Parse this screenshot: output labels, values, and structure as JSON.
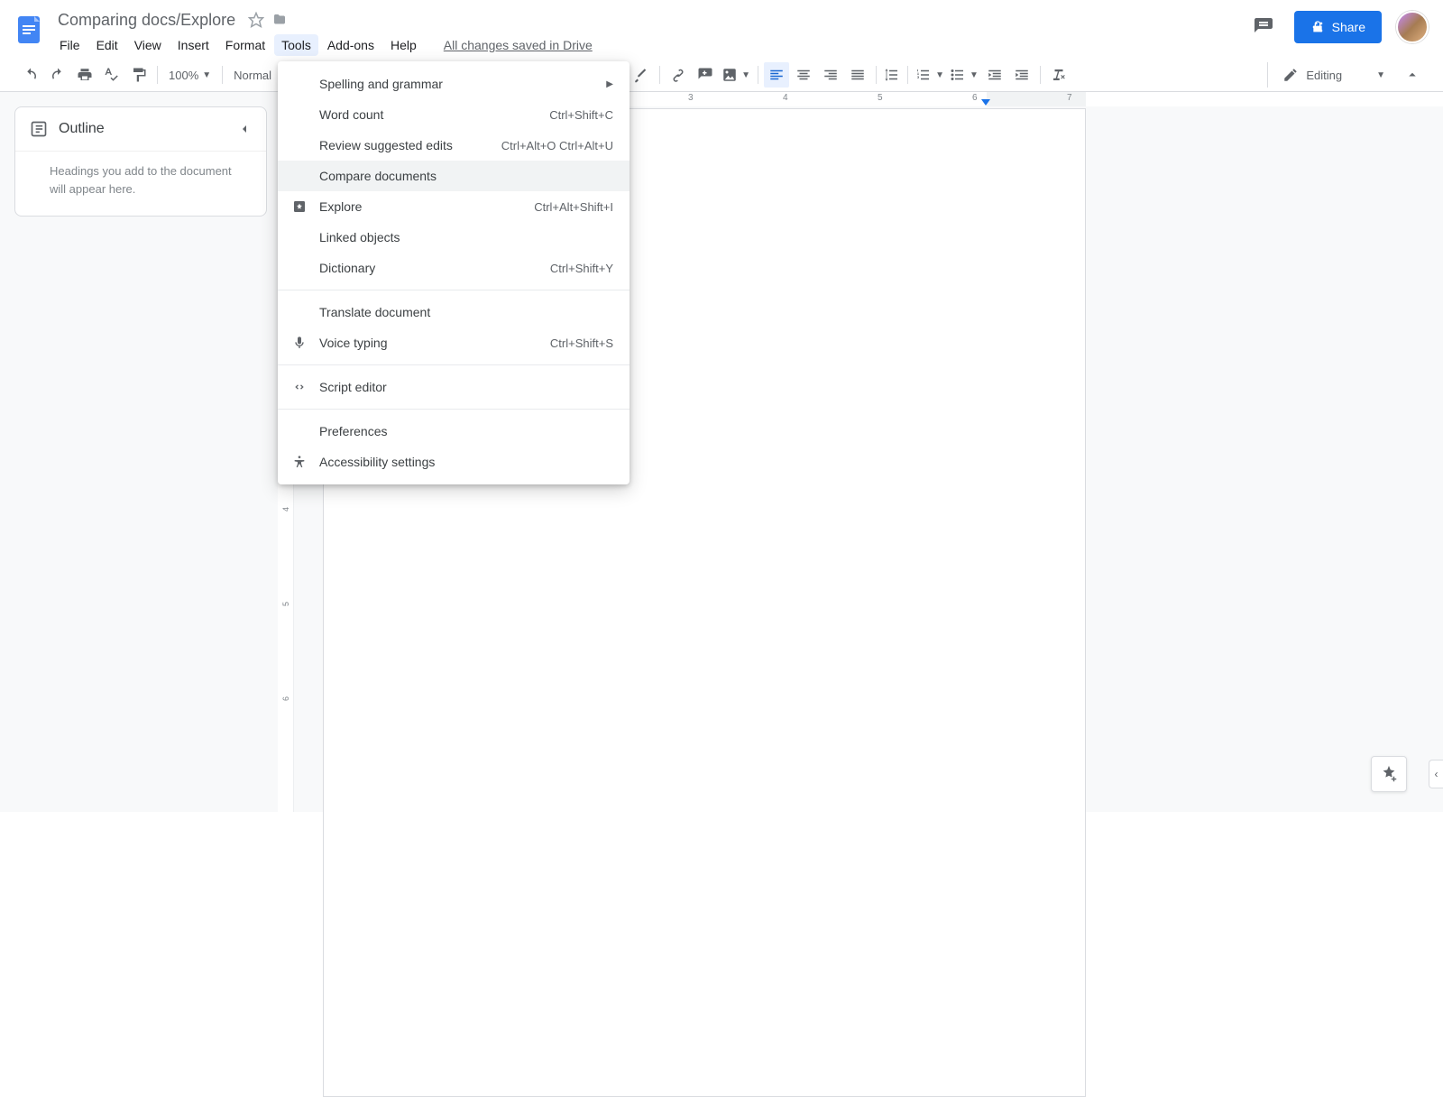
{
  "doc": {
    "title": "Comparing docs/Explore",
    "save_status": "All changes saved in Drive"
  },
  "menubar": {
    "file": "File",
    "edit": "Edit",
    "view": "View",
    "insert": "Insert",
    "format": "Format",
    "tools": "Tools",
    "addons": "Add-ons",
    "help": "Help"
  },
  "share": {
    "label": "Share"
  },
  "toolbar": {
    "zoom": "100%",
    "style": "Normal",
    "mode": "Editing"
  },
  "outline": {
    "title": "Outline",
    "empty": "Headings you add to the document will appear here."
  },
  "ruler": {
    "hnums": [
      "3",
      "4",
      "5",
      "6",
      "7"
    ]
  },
  "tools_menu": {
    "spelling": {
      "label": "Spelling and grammar"
    },
    "wordcount": {
      "label": "Word count",
      "shortcut": "Ctrl+Shift+C"
    },
    "review": {
      "label": "Review suggested edits",
      "shortcut": "Ctrl+Alt+O Ctrl+Alt+U"
    },
    "compare": {
      "label": "Compare documents"
    },
    "explore": {
      "label": "Explore",
      "shortcut": "Ctrl+Alt+Shift+I"
    },
    "linked": {
      "label": "Linked objects"
    },
    "dictionary": {
      "label": "Dictionary",
      "shortcut": "Ctrl+Shift+Y"
    },
    "translate": {
      "label": "Translate document"
    },
    "voice": {
      "label": "Voice typing",
      "shortcut": "Ctrl+Shift+S"
    },
    "script": {
      "label": "Script editor"
    },
    "prefs": {
      "label": "Preferences"
    },
    "a11y": {
      "label": "Accessibility settings"
    }
  }
}
